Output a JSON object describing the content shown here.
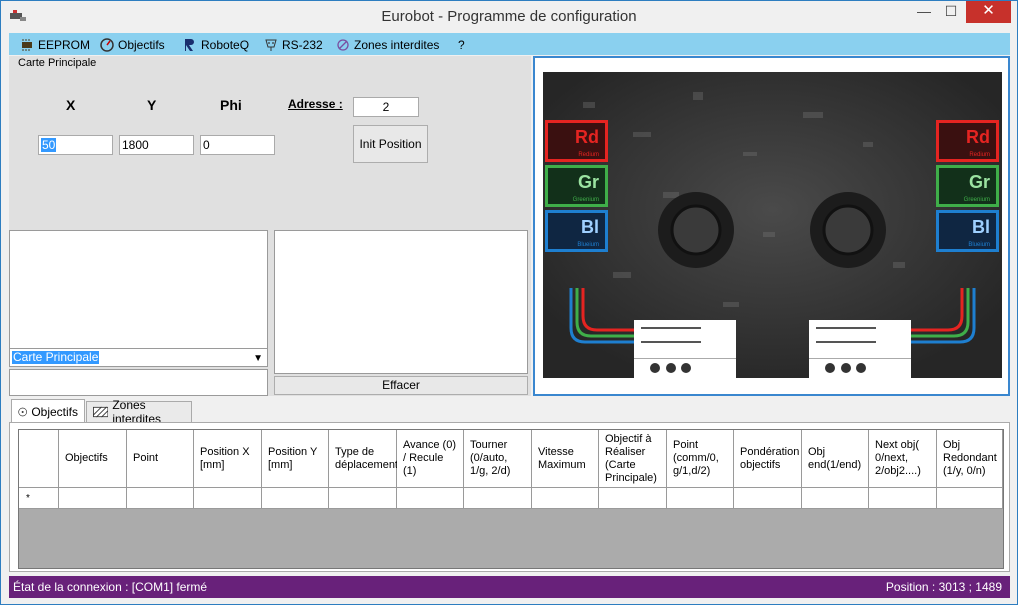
{
  "window": {
    "title": "Eurobot - Programme de configuration",
    "minimize_glyph": "—",
    "maximize_glyph": "☐",
    "close_glyph": "✕"
  },
  "menu": {
    "items": [
      {
        "label": "EEPROM",
        "icon": "eeprom-chip-icon"
      },
      {
        "label": "Objectifs",
        "icon": "gauge-icon"
      },
      {
        "label": "RoboteQ",
        "icon": "roboteq-logo-icon"
      },
      {
        "label": "RS-232",
        "icon": "serial-port-icon"
      },
      {
        "label": "Zones interdites",
        "icon": "forbidden-zone-icon"
      },
      {
        "label": "?"
      }
    ]
  },
  "config": {
    "group_label": "Carte Principale",
    "x_label": "X",
    "y_label": "Y",
    "phi_label": "Phi",
    "x_value": "50",
    "y_value": "1800",
    "phi_value": "0",
    "adresse_label": "Adresse :",
    "adresse_value": "2",
    "init_button": "Init Position",
    "combo_value": "Carte Principale",
    "effacer_button": "Effacer"
  },
  "board": {
    "badges": [
      {
        "symbol": "Rd",
        "name": "Redium",
        "color": "#e52421"
      },
      {
        "symbol": "Gr",
        "name": "Greenium",
        "color": "#3fae49"
      },
      {
        "symbol": "Bl",
        "name": "Blueium",
        "color": "#1e7fd0"
      }
    ]
  },
  "tabs": [
    {
      "label": "Objectifs",
      "icon": "target-icon",
      "active": true
    },
    {
      "label": "Zones interdites",
      "icon": "hatch-icon",
      "active": false
    }
  ],
  "grid": {
    "columns": [
      "Objectifs",
      "Point",
      "Position X [mm]",
      "Position Y [mm]",
      "Type de déplacement",
      "Avance (0) / Recule (1)",
      "Tourner (0/auto, 1/g, 2/d)",
      "Vitesse Maximum",
      "Objectif à Réaliser (Carte Principale)",
      "Point (comm/0, g/1,d/2)",
      "Pondération objectifs",
      "Obj end(1/end)",
      "Next obj( 0/next, 2/obj2....)",
      "Obj Redondant (1/y, 0/n)"
    ],
    "new_row_marker": "*"
  },
  "status": {
    "connection": "État de la connexion : [COM1] fermé",
    "position": "Position : 3013 ; 1489"
  }
}
